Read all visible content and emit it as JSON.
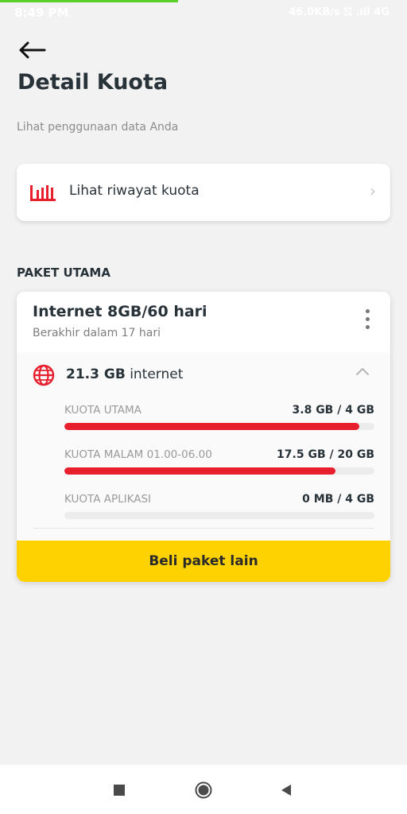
{
  "status_bar": {
    "time": "8:49 PM",
    "network": "46.0KB/s ⛞ .ıll 4G"
  },
  "header": {
    "title": "Detail Kuota",
    "subtitle": "Lihat penggunaan data Anda"
  },
  "history": {
    "label": "Lihat riwayat kuota",
    "icon": "chart-bars-icon"
  },
  "section": {
    "title": "PAKET UTAMA"
  },
  "package": {
    "name": "Internet 8GB/60 hari",
    "expiry": "Berakhir dalam 17 hari",
    "total_amount": "21.3 GB",
    "total_suffix": "internet",
    "quotas": [
      {
        "label": "KUOTA UTAMA",
        "value": "3.8 GB / 4 GB",
        "fraction": 0.95
      },
      {
        "label": "KUOTA MALAM 01.00-06.00",
        "value": "17.5 GB / 20 GB",
        "fraction": 0.875
      },
      {
        "label": "KUOTA APLIKASI",
        "value": "0 MB / 4 GB",
        "fraction": 0
      }
    ],
    "buy_label": "Beli paket lain"
  },
  "colors": {
    "accent_red": "#e8202e",
    "button_yellow": "#fdd200",
    "status_green": "#5bd12a"
  }
}
